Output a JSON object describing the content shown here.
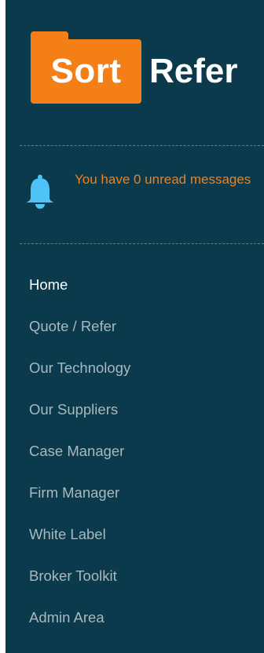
{
  "logo": {
    "part1": "Sort",
    "part2": "Refer"
  },
  "notification": {
    "icon": "bell-icon",
    "text": "You have 0 unread messages"
  },
  "nav": {
    "items": [
      {
        "label": "Home",
        "active": true
      },
      {
        "label": "Quote / Refer",
        "active": false
      },
      {
        "label": "Our Technology",
        "active": false
      },
      {
        "label": "Our Suppliers",
        "active": false
      },
      {
        "label": "Case Manager",
        "active": false
      },
      {
        "label": "Firm Manager",
        "active": false
      },
      {
        "label": "White Label",
        "active": false
      },
      {
        "label": "Broker Toolkit",
        "active": false
      },
      {
        "label": "Admin Area",
        "active": false
      }
    ]
  },
  "colors": {
    "sidebar_bg": "#0a3a4b",
    "accent": "#f57f17",
    "bell": "#4fc3f7",
    "nav_text": "#aab8bf",
    "nav_active": "#ffffff"
  }
}
